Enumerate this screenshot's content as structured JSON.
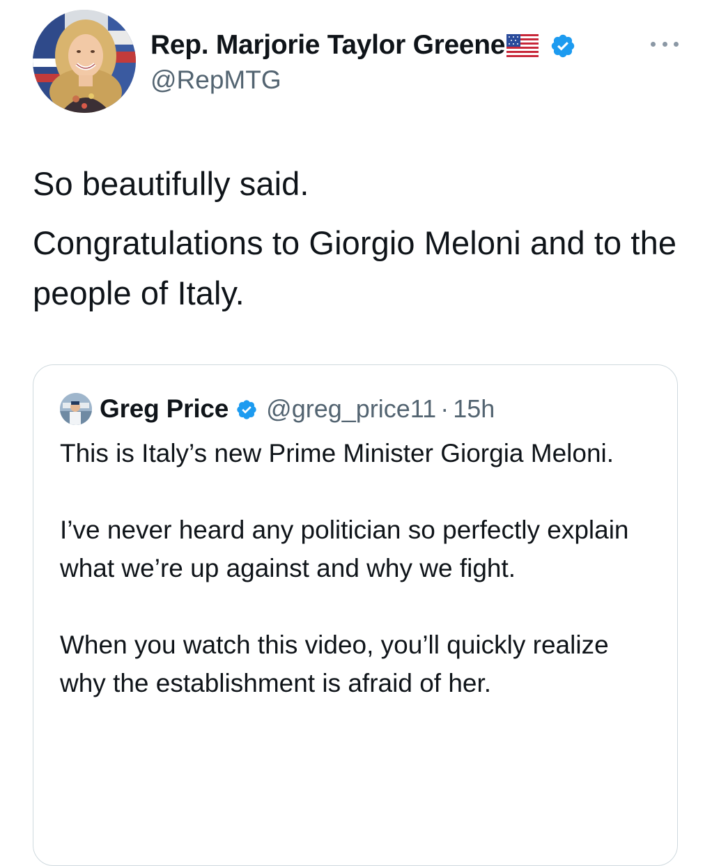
{
  "author": {
    "name": "Rep. Marjorie Taylor Greene",
    "handle": "@RepMTG",
    "flag_icon": "us-flag-emoji",
    "verified_icon": "verified-badge-icon"
  },
  "tweet": {
    "paragraphs": [
      "So beautifully said.",
      "Congratulations to Giorgio Meloni and to the people of Italy."
    ]
  },
  "quoted_tweet": {
    "name": "Greg Price",
    "handle": "@greg_price11",
    "separator": "·",
    "time": "15h",
    "paragraphs": [
      "This is Italy’s new Prime Minister Giorgia Meloni.",
      "I’ve never heard any politician so perfectly explain what we’re up against and why we fight.",
      "When you watch this video, you’ll quickly realize why the establishment is afraid of her."
    ]
  },
  "colors": {
    "text": "#0f1419",
    "secondary": "#536471",
    "verified": "#1d9bf0",
    "border": "#cfd9de"
  }
}
